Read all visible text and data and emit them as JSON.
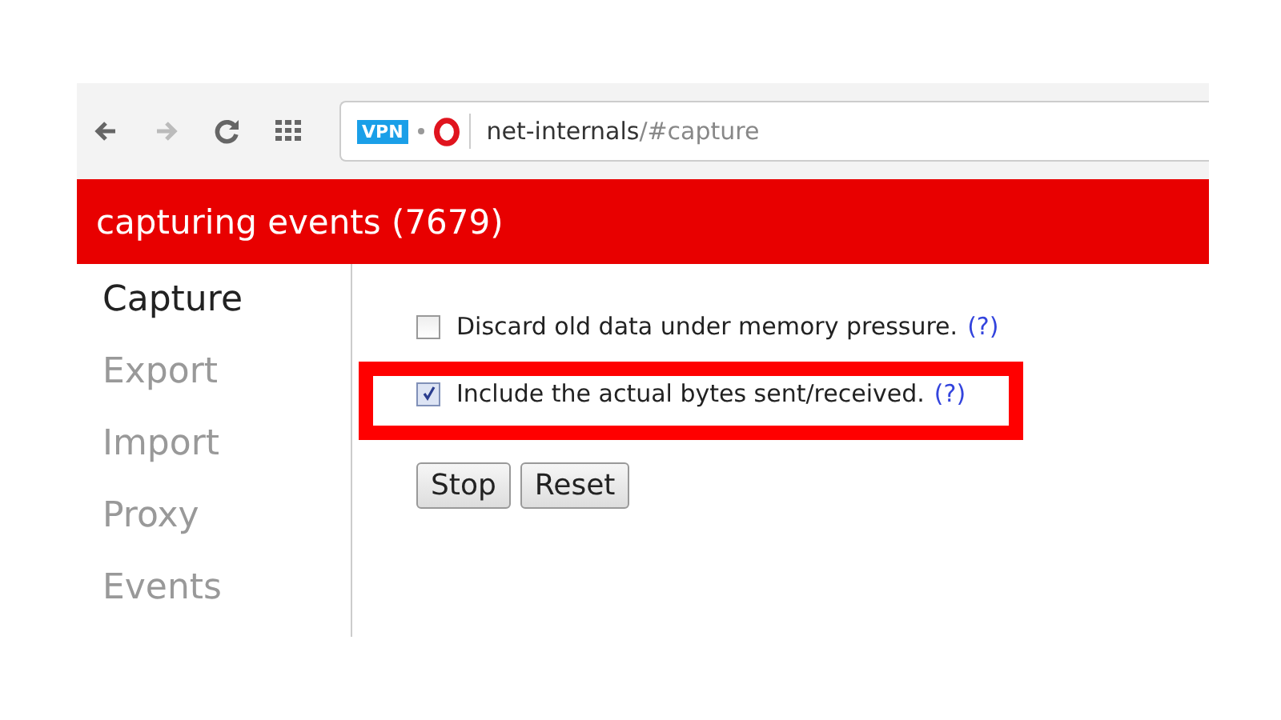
{
  "toolbar": {
    "nav_buttons": [
      {
        "kind": "back",
        "disabled": false
      },
      {
        "kind": "forward",
        "disabled": true
      },
      {
        "kind": "reload",
        "disabled": false
      },
      {
        "kind": "apps",
        "disabled": false
      }
    ],
    "address": {
      "badge": "VPN",
      "host": "net-internals",
      "path": "/#capture"
    }
  },
  "header": {
    "title": "capturing events (7679)"
  },
  "sidebar": {
    "items": [
      {
        "label": "Capture",
        "selected": true
      },
      {
        "label": "Export",
        "selected": false
      },
      {
        "label": "Import",
        "selected": false
      },
      {
        "label": "Proxy",
        "selected": false
      },
      {
        "label": "Events",
        "selected": false
      }
    ]
  },
  "options": [
    {
      "label": "Discard old data under memory pressure.",
      "help": "(?)",
      "checked": false,
      "highlighted": false
    },
    {
      "label": "Include the actual bytes sent/received.",
      "help": "(?)",
      "checked": true,
      "highlighted": true
    }
  ],
  "buttons": [
    "Stop",
    "Reset"
  ]
}
